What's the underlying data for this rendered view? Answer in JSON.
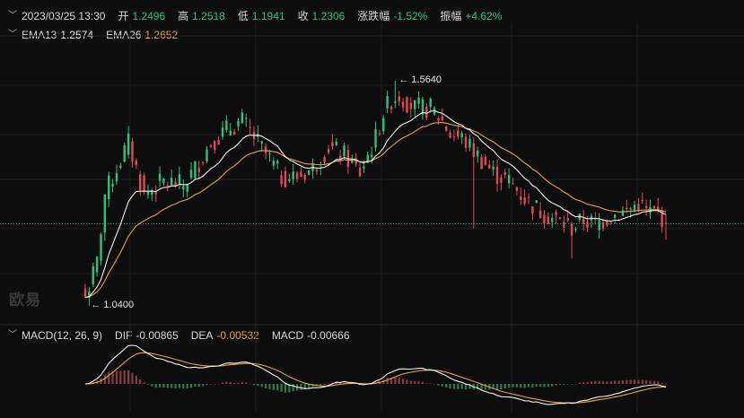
{
  "header": {
    "datetime": "2023/03/25 13:30",
    "open_label": "开",
    "open": "1.2496",
    "high_label": "高",
    "high": "1.2518",
    "low_label": "低",
    "low": "1.1941",
    "close_label": "收",
    "close": "1.2306",
    "change_label": "涨跌幅",
    "change": "-1.52%",
    "amplitude_label": "振幅",
    "amplitude": "+4.62%"
  },
  "ema_legend": {
    "ema13_label": "EMA13",
    "ema13_value": "1.2574",
    "ema26_label": "EMA26",
    "ema26_value": "1.2652"
  },
  "macd_legend": {
    "title": "MACD(12, 26, 9)",
    "dif_label": "DIF",
    "dif_value": "-0.00865",
    "dea_label": "DEA",
    "dea_value": "-0.00532",
    "macd_label": "MACD",
    "macd_value": "-0.00666"
  },
  "watermark": "欧易",
  "colors": {
    "up": "#2ec27e",
    "down": "#e24a5a",
    "ema13": "#f2f2f2",
    "ema26": "#e8a437",
    "grid": "#1e1e1e",
    "current_price_line": "#2ec27e"
  },
  "chart_data": [
    {
      "type": "candlestick",
      "title": "",
      "ylim": [
        1.0,
        1.7
      ],
      "current_price": 1.2306,
      "annotations": [
        {
          "text": "← 1.5640",
          "price": 1.564,
          "index": 79
        },
        {
          "text": "← 1.0400",
          "price": 1.04,
          "index": 1
        }
      ],
      "series": [
        {
          "name": "EMA13",
          "legend_value": 1.2574
        },
        {
          "name": "EMA26",
          "legend_value": 1.2652
        }
      ],
      "keypoints_close": [
        [
          0,
          1.06
        ],
        [
          3,
          1.14
        ],
        [
          5,
          1.3
        ],
        [
          9,
          1.38
        ],
        [
          11,
          1.42
        ],
        [
          15,
          1.3
        ],
        [
          20,
          1.33
        ],
        [
          25,
          1.32
        ],
        [
          28,
          1.36
        ],
        [
          32,
          1.42
        ],
        [
          36,
          1.45
        ],
        [
          40,
          1.47
        ],
        [
          44,
          1.42
        ],
        [
          47,
          1.38
        ],
        [
          50,
          1.34
        ],
        [
          54,
          1.34
        ],
        [
          58,
          1.36
        ],
        [
          62,
          1.41
        ],
        [
          66,
          1.39
        ],
        [
          70,
          1.35
        ],
        [
          74,
          1.43
        ],
        [
          76,
          1.49
        ],
        [
          78,
          1.52
        ],
        [
          80,
          1.53
        ],
        [
          84,
          1.5
        ],
        [
          88,
          1.5
        ],
        [
          91,
          1.47
        ],
        [
          93,
          1.44
        ],
        [
          96,
          1.43
        ],
        [
          100,
          1.39
        ],
        [
          104,
          1.35
        ],
        [
          108,
          1.33
        ],
        [
          112,
          1.29
        ],
        [
          116,
          1.26
        ],
        [
          120,
          1.24
        ],
        [
          124,
          1.22
        ],
        [
          127,
          1.24
        ],
        [
          130,
          1.23
        ],
        [
          134,
          1.25
        ],
        [
          138,
          1.26
        ],
        [
          141,
          1.28
        ],
        [
          143,
          1.26
        ],
        [
          146,
          1.255
        ],
        [
          148,
          1.235
        ]
      ]
    },
    {
      "type": "macd",
      "title": "MACD(12, 26, 9)",
      "series": [
        {
          "name": "DIF",
          "legend_value": -0.00865
        },
        {
          "name": "DEA",
          "legend_value": -0.00532
        },
        {
          "name": "MACD",
          "legend_value": -0.00666
        }
      ]
    }
  ]
}
